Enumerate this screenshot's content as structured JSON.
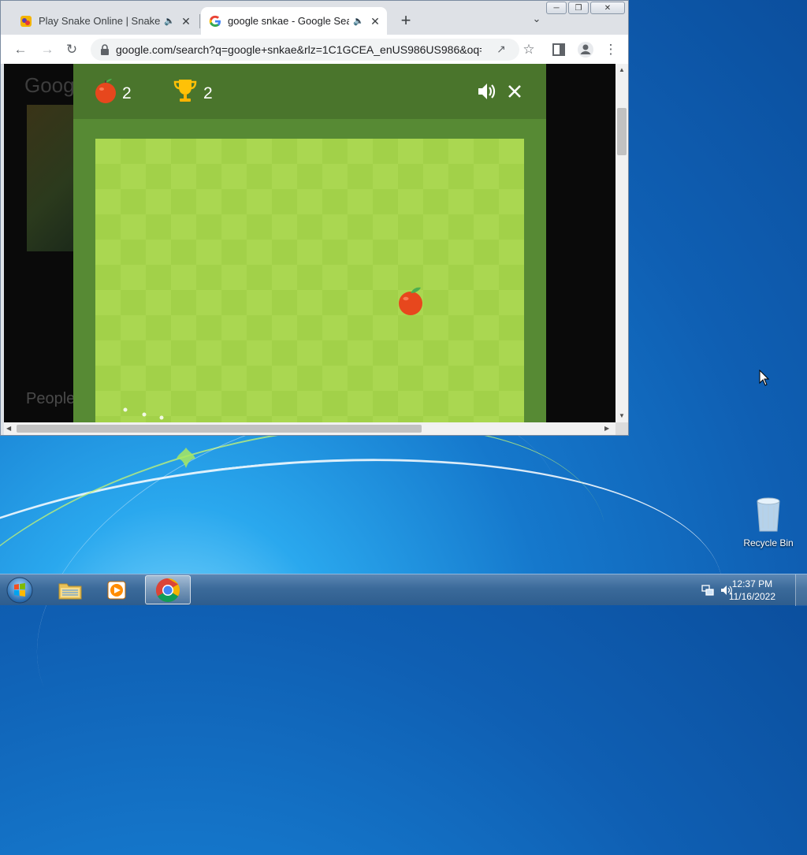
{
  "browser": {
    "tabs": [
      {
        "title": "Play Snake Online | Snake.io",
        "favicon": "snake-io-icon",
        "audio": "speaker-icon",
        "active": false
      },
      {
        "title": "google snkae - Google Searc",
        "favicon": "google-g-icon",
        "audio": "speaker-icon",
        "active": true
      }
    ],
    "new_tab_label": "+",
    "address_bar": {
      "url": "google.com/search?q=google+snkae&rlz=1C1GCEA_enUS986US986&oq=..."
    },
    "background_page": {
      "logo_text": "Goog",
      "section_text": "People"
    }
  },
  "game": {
    "apples_score": "2",
    "best_score": "2",
    "board": {
      "cols": 17,
      "rows": 12,
      "apple": {
        "col": 12,
        "row": 6
      }
    },
    "colors": {
      "header": "#4a752c",
      "frame": "#578a34",
      "light_tile": "#aad751",
      "dark_tile": "#a2d149",
      "apple": "#e7471d"
    }
  },
  "desktop": {
    "icons": [
      {
        "label": "Recycle Bin",
        "icon": "recycle-bin-icon"
      }
    ]
  },
  "taskbar": {
    "apps": [
      {
        "name": "start-button",
        "icon": "windows-orb-icon"
      },
      {
        "name": "file-explorer",
        "icon": "folder-icon"
      },
      {
        "name": "media-player",
        "icon": "media-player-icon"
      },
      {
        "name": "chrome",
        "icon": "chrome-icon",
        "active": true
      }
    ],
    "clock": {
      "time": "12:37 PM",
      "date": "11/16/2022"
    }
  }
}
